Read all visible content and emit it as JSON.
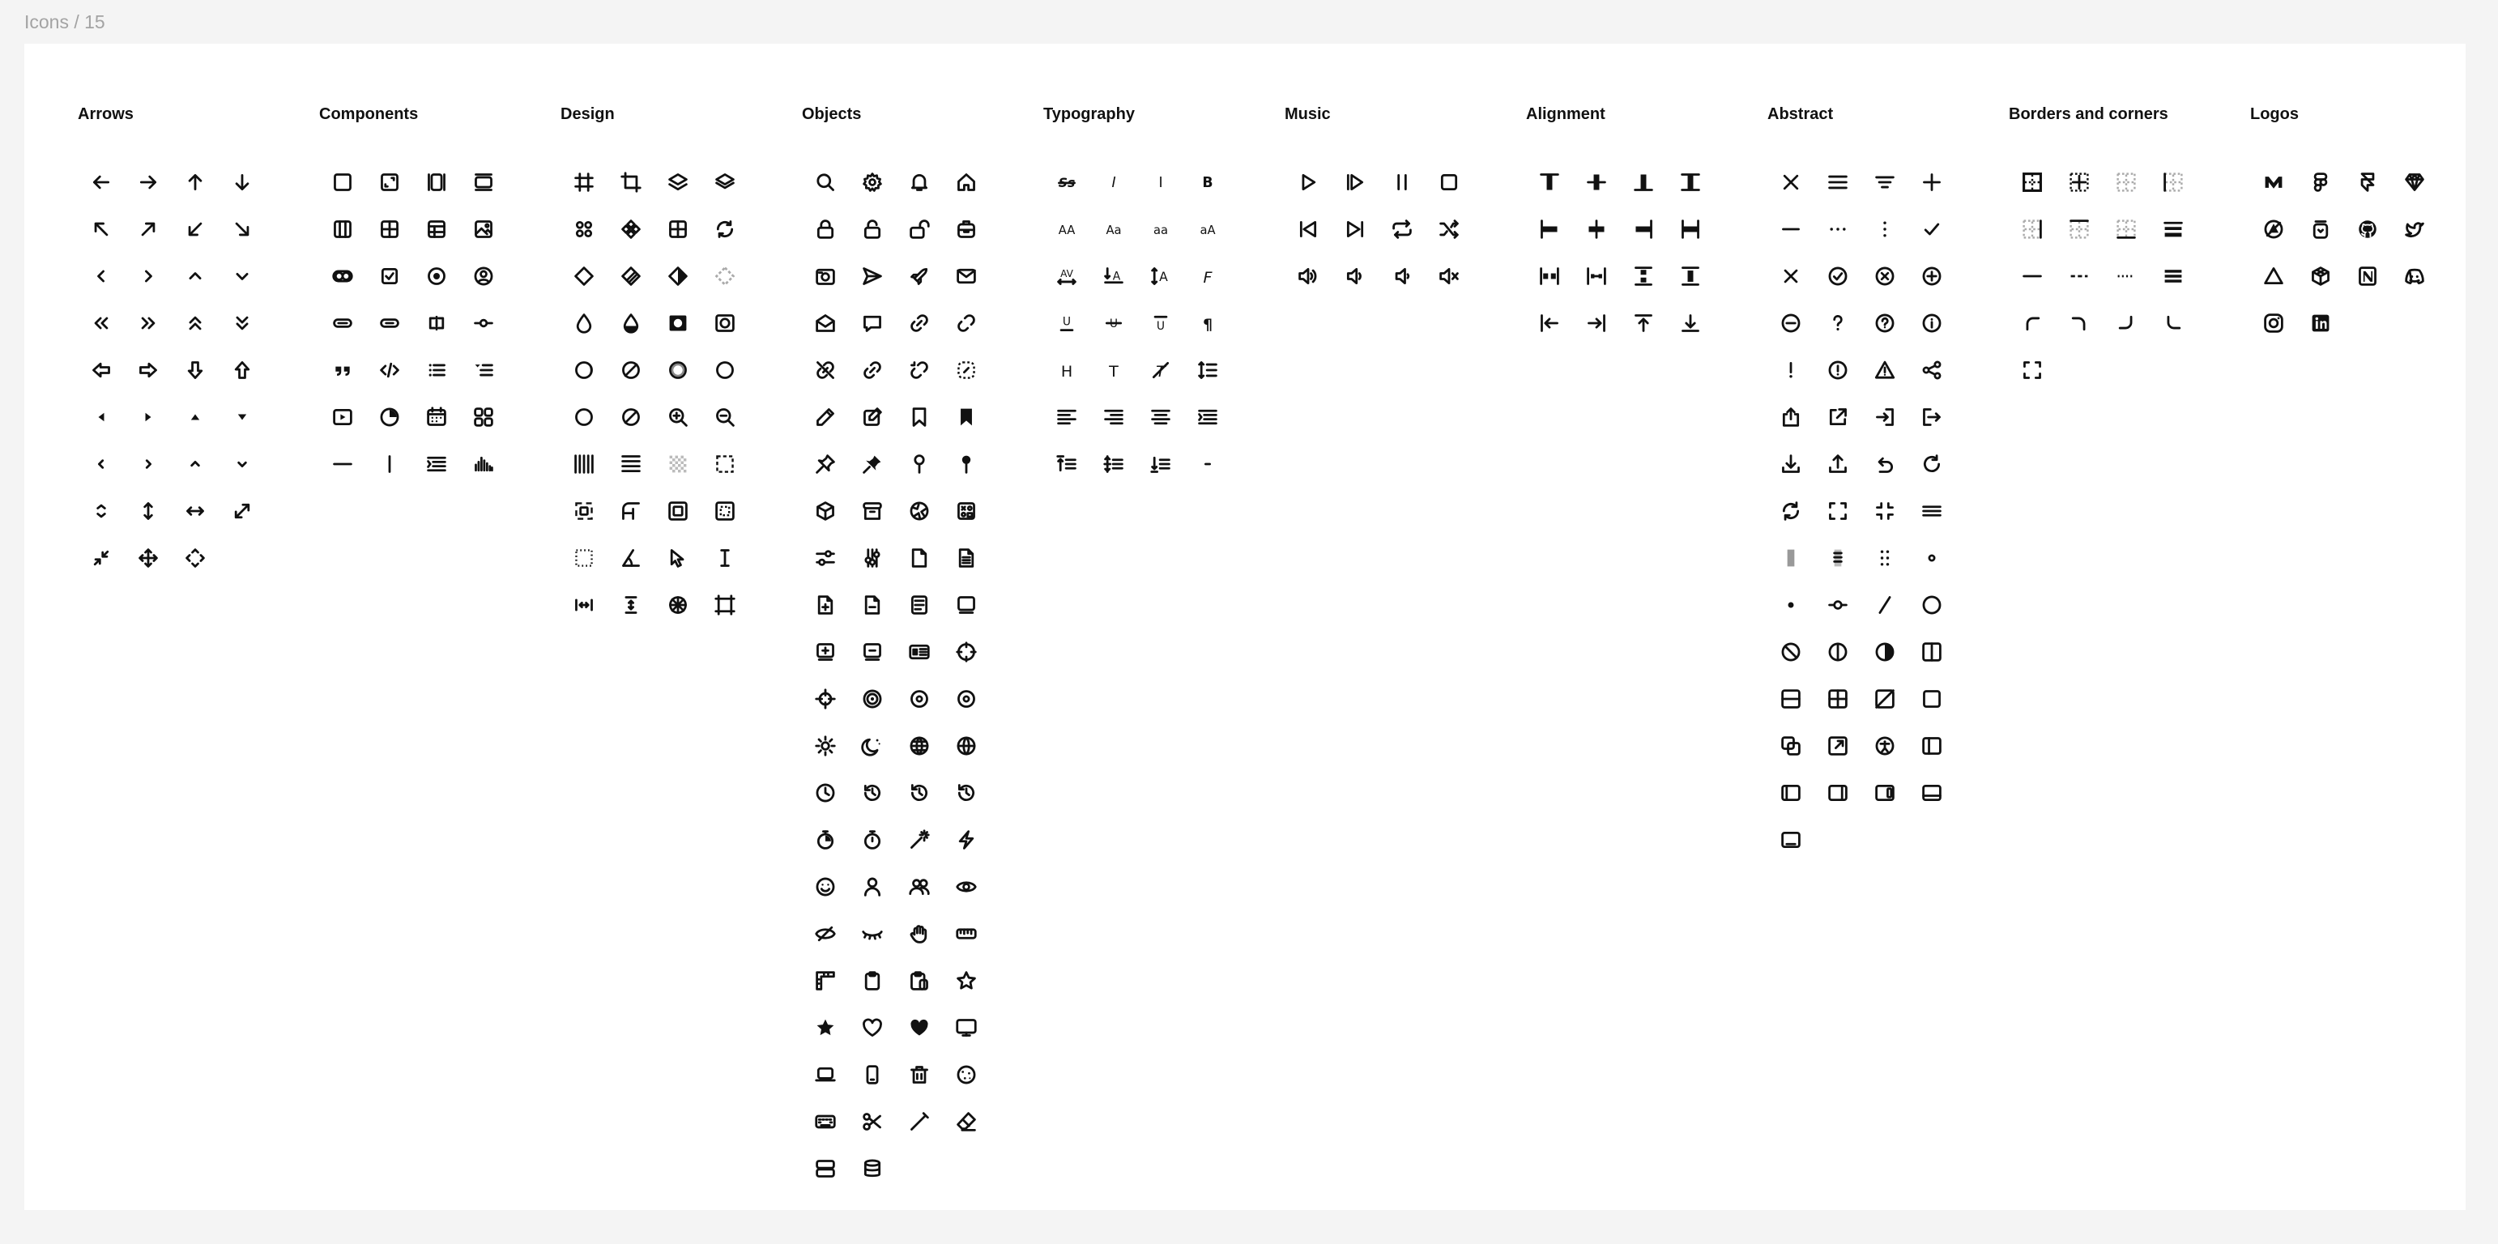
{
  "breadcrumb": "Icons / 15",
  "categories": [
    {
      "title": "Arrows",
      "icons": [
        "arrow-left",
        "arrow-right",
        "arrow-up",
        "arrow-down",
        "arrow-top-left",
        "arrow-top-right",
        "arrow-bottom-left",
        "arrow-bottom-right",
        "chevron-left",
        "chevron-right",
        "chevron-up",
        "chevron-down",
        "double-arrow-left",
        "double-arrow-right",
        "double-arrow-up",
        "double-arrow-down",
        "thick-arrow-left",
        "thick-arrow-right",
        "thick-arrow-down",
        "thick-arrow-up",
        "triangle-left",
        "triangle-right",
        "triangle-up",
        "triangle-down",
        "caret-left",
        "caret-right",
        "caret-up",
        "caret-down",
        "caret-sort",
        "height",
        "width",
        "size",
        "exit-full-screen",
        "move",
        "enter-full-screen"
      ]
    },
    {
      "title": "Components",
      "icons": [
        "box",
        "aspect-ratio",
        "container",
        "section",
        "columns",
        "grid",
        "table",
        "image",
        "switch",
        "checkbox",
        "radiobutton",
        "avatar",
        "button",
        "token",
        "input",
        "slider",
        "quote",
        "code",
        "list-bullet",
        "dropdown-menu",
        "video",
        "pie-chart",
        "calendar",
        "dashboard",
        "divider-horizontal",
        "divider-vertical",
        "text-align-justify",
        "activity-log"
      ]
    },
    {
      "title": "Design",
      "icons": [
        "frame",
        "crop",
        "layers",
        "stack",
        "tokens",
        "component",
        "grid-layout",
        "rotate",
        "component-1",
        "component-2",
        "component-instance",
        "component-none",
        "drop",
        "mix",
        "masking-off",
        "masking-on",
        "shadow",
        "shadow-none",
        "shadow-inner",
        "shadow-outer",
        "value",
        "value-none",
        "zoom-in",
        "zoom-out",
        "column-spacing",
        "row-spacing",
        "transparency-grid",
        "dashed-square",
        "corners",
        "corner-radius",
        "frame-inset",
        "frame-alt",
        "dotted-square",
        "angle",
        "cursor-arrow",
        "cursor-text",
        "width-spacing",
        "height-spacing",
        "blending-mode",
        "crop-frame"
      ]
    },
    {
      "title": "Objects",
      "icons": [
        "magnifying-glass",
        "gear",
        "bell",
        "home",
        "lock-closed",
        "lock-open",
        "lock-open-2",
        "backpack",
        "camera",
        "paper-plane",
        "rocket",
        "envelope-closed",
        "envelope-open",
        "chat-bubble",
        "link",
        "link-break",
        "link-none",
        "link-2",
        "link-break-2",
        "link-none-2",
        "pencil",
        "pencil-square",
        "bookmark",
        "bookmark-filled",
        "drawing-pin",
        "drawing-pin-filled",
        "sewing-pin",
        "sewing-pin-filled",
        "cube",
        "archive",
        "crumpled-paper",
        "mixer",
        "mixer-horizontal",
        "mixer-vertical",
        "file",
        "file-text",
        "file-plus",
        "file-minus",
        "reader",
        "card-stack",
        "card-stack-plus",
        "card-stack-minus",
        "id-card",
        "crosshair",
        "target",
        "target-2",
        "ring",
        "dot-target",
        "sun",
        "moon",
        "globe",
        "globe-2",
        "clock",
        "counter-clockwise",
        "reset",
        "timer",
        "stopwatch",
        "stopwatch-2",
        "magic-wand",
        "lightning",
        "face",
        "person",
        "people",
        "eye-open",
        "eye-none",
        "eye-closed",
        "hand",
        "ruler-horizontal",
        "ruler-square",
        "clipboard",
        "clipboard-copy",
        "star",
        "star-filled",
        "heart",
        "heart-filled",
        "desktop",
        "laptop",
        "mobile",
        "trash",
        "cookie",
        "keyboard",
        "scissors",
        "pencil-thin",
        "eraser",
        "layout-rows",
        "database"
      ]
    },
    {
      "title": "Typography",
      "icons": [
        "strikethrough-text",
        "font-italic",
        "font-roman",
        "font-bold",
        "letter-case-uppercase",
        "letter-case-capitalize",
        "letter-case-lowercase",
        "letter-case-toggle",
        "letter-spacing",
        "align-baseline",
        "font-size",
        "font-family",
        "underline",
        "strikethrough",
        "overline",
        "pilcrow",
        "heading",
        "text",
        "text-none",
        "line-height",
        "text-align-left",
        "text-align-right",
        "text-align-center",
        "text-align-justify",
        "line-height-top",
        "line-height-middle",
        "line-height-bottom",
        "dash"
      ]
    },
    {
      "title": "Music",
      "icons": [
        "play",
        "resume",
        "pause",
        "stop",
        "track-previous",
        "track-next",
        "loop",
        "shuffle",
        "speaker-loud",
        "speaker-moderate",
        "speaker-quiet",
        "speaker-off"
      ]
    },
    {
      "title": "Alignment",
      "icons": [
        "align-top",
        "align-center-vertically",
        "align-bottom",
        "stretch-vertically",
        "align-left",
        "align-center-horizontally",
        "align-right",
        "stretch-horizontally",
        "space-between-horizontally",
        "space-evenly-horizontally",
        "space-between-vertically",
        "space-evenly-vertically",
        "pin-left",
        "pin-right",
        "pin-top",
        "pin-bottom"
      ]
    },
    {
      "title": "Abstract",
      "icons": [
        "cross",
        "hamburger",
        "mixer-lines",
        "plus",
        "minus",
        "dots-horizontal",
        "dots-vertical",
        "check",
        "cross-circle-x",
        "check-circle",
        "cross-circle",
        "plus-circle",
        "minus-circle",
        "question-mark",
        "question-mark-circle",
        "info-circle",
        "exclamation",
        "exclamation-circle",
        "exclamation-triangle",
        "share",
        "share-box",
        "external-link",
        "enter",
        "exit",
        "download",
        "upload",
        "reset-arrow",
        "reload",
        "update",
        "all-sides",
        "exit-full",
        "menu-lines",
        "drag-handle-vertical",
        "drag-handle-dots-1",
        "drag-handle-dots-2",
        "dot",
        "dot-filled",
        "commit",
        "slash",
        "circle",
        "circle-backslash",
        "half-1",
        "half-2",
        "view-vertical",
        "view-horizontal",
        "view-grid",
        "box-model",
        "square",
        "copy",
        "open-in-new",
        "accessibility",
        "layout-sidebar",
        "layout-left",
        "layout-right",
        "layout-right-2",
        "layout-bottom",
        "layout-bottom-2"
      ]
    },
    {
      "title": "Borders and corners",
      "icons": [
        "border-all",
        "border-split",
        "border-none",
        "border-left",
        "border-right",
        "border-top",
        "border-bottom",
        "border-width",
        "border-solid",
        "border-dashed",
        "border-dotted",
        "border-thick",
        "corner-top-left",
        "corner-top-right",
        "corner-bottom-right",
        "corner-bottom-left",
        "corners-dashed"
      ]
    },
    {
      "title": "Logos",
      "icons": [
        "modulz-logo",
        "figma-logo",
        "framer-logo",
        "sketch-logo",
        "vercel-logo",
        "iconjar-logo",
        "github-logo",
        "twitter-logo",
        "triangle-logo",
        "codesandbox-logo",
        "notion-logo",
        "discord-logo",
        "instagram-logo",
        "linkedin-logo"
      ]
    }
  ]
}
